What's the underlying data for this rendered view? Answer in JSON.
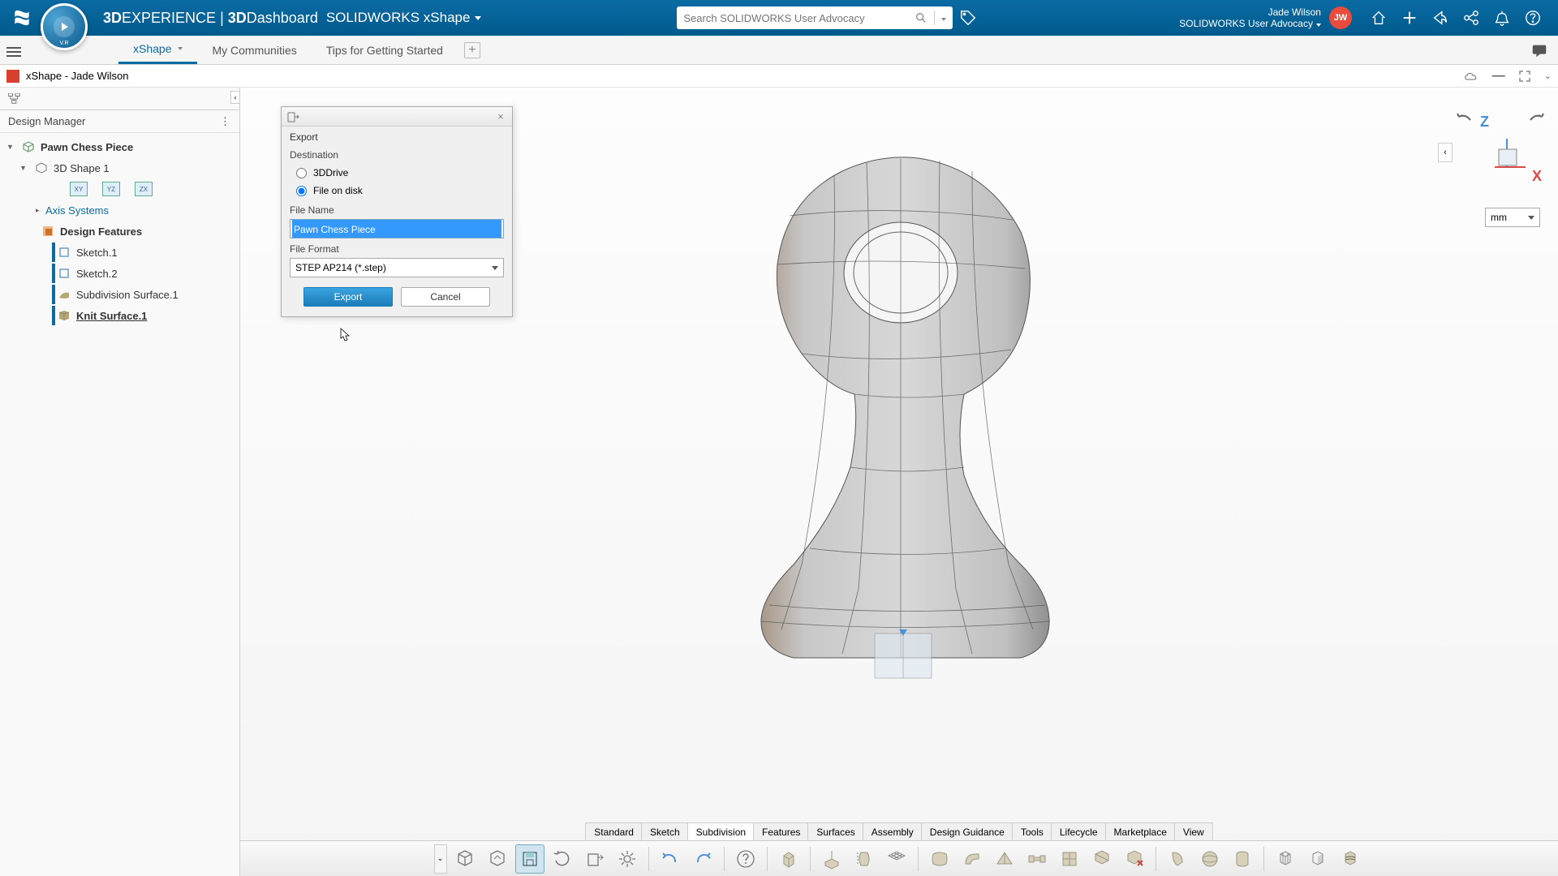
{
  "header": {
    "brand_prefix": "3D",
    "brand_mid": "EXPERIENCE",
    "brand_sep": " | ",
    "brand_dash_prefix": "3D",
    "brand_dash": "Dashboard",
    "app_name": "SOLIDWORKS xShape",
    "search_placeholder": "Search SOLIDWORKS User Advocacy",
    "user_name": "Jade Wilson",
    "user_group": "SOLIDWORKS User Advocacy",
    "avatar_initials": "JW",
    "compass_label": "V.R"
  },
  "tabs": [
    {
      "label": "xShape",
      "active": true,
      "dropdown": true
    },
    {
      "label": "My Communities",
      "active": false
    },
    {
      "label": "Tips for Getting Started",
      "active": false
    }
  ],
  "document": {
    "title": "xShape - Jade Wilson"
  },
  "design_manager": {
    "title": "Design Manager",
    "root": "Pawn Chess Piece",
    "shape": "3D Shape 1",
    "planes": [
      "XY",
      "YZ",
      "ZX"
    ],
    "axis_systems": "Axis Systems",
    "design_features": "Design Features",
    "features": [
      {
        "label": "Sketch.1"
      },
      {
        "label": "Sketch.2"
      },
      {
        "label": "Subdivision Surface.1"
      },
      {
        "label": "Knit Surface.1",
        "underline": true
      }
    ]
  },
  "export_dialog": {
    "title": "Export",
    "destination_label": "Destination",
    "options": [
      {
        "label": "3DDrive",
        "checked": false
      },
      {
        "label": "File on disk",
        "checked": true
      }
    ],
    "filename_label": "File Name",
    "filename_value": "Pawn Chess Piece",
    "format_label": "File Format",
    "format_value": "STEP AP214 (*.step)",
    "export_btn": "Export",
    "cancel_btn": "Cancel"
  },
  "viewport": {
    "units": "mm",
    "axes": {
      "z": "Z",
      "x": "X"
    }
  },
  "tool_tabs": [
    "Standard",
    "Sketch",
    "Subdivision",
    "Features",
    "Surfaces",
    "Assembly",
    "Design Guidance",
    "Tools",
    "Lifecycle",
    "Marketplace",
    "View"
  ],
  "tool_tabs_active": "Subdivision"
}
